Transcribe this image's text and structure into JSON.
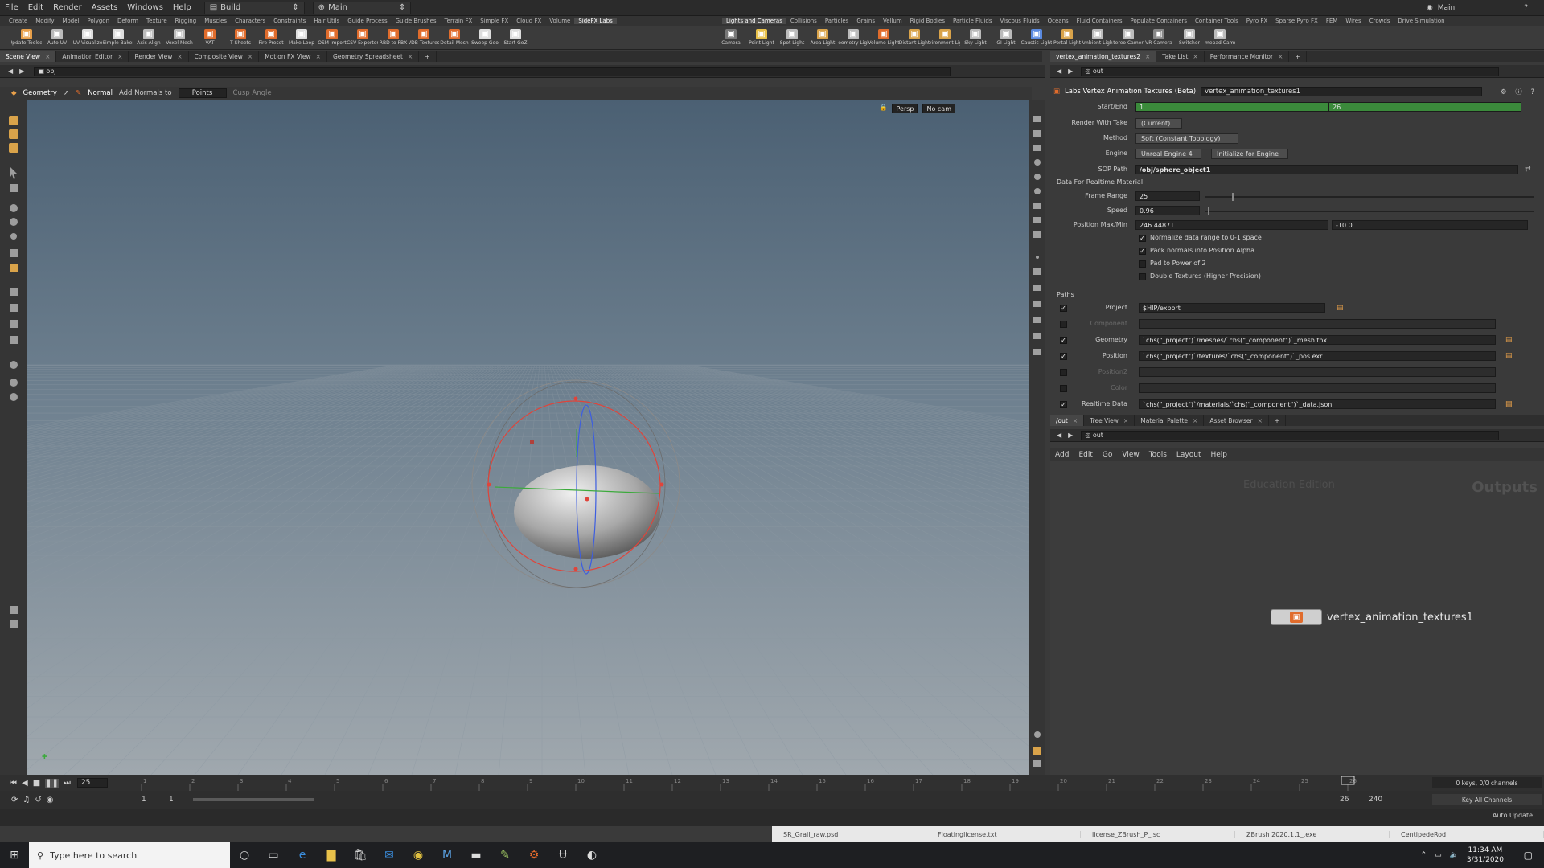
{
  "menubar": {
    "items": [
      "File",
      "Edit",
      "Render",
      "Assets",
      "Windows",
      "Help"
    ],
    "desktop": "Build",
    "context": "Main",
    "right_desktop": "Main"
  },
  "shelf_tabs_left": [
    "Create",
    "Modify",
    "Model",
    "Polygon",
    "Deform",
    "Texture",
    "Rigging",
    "Muscles",
    "Characters",
    "Constraints",
    "Hair Utils",
    "Guide Process",
    "Guide Brushes",
    "Terrain FX",
    "Simple FX",
    "Cloud FX",
    "Volume",
    "SideFX Labs"
  ],
  "shelf_tools_left": [
    "Update Toolset",
    "Auto UV",
    "UV Visualize",
    "Simple Baker",
    "Axis Align",
    "Voxel Mesh",
    "VAT",
    "T Sheets",
    "Fire Preset",
    "Make Loop",
    "OSM Import",
    "CSV Exporter",
    "RBD to FBX",
    "VDB Textures",
    "Detail Mesh",
    "Sweep Geo",
    "Start GoZ"
  ],
  "shelf_tabs_right": [
    "Lights and Cameras",
    "Collisions",
    "Particles",
    "Grains",
    "Vellum",
    "Rigid Bodies",
    "Particle Fluids",
    "Viscous Fluids",
    "Oceans",
    "Fluid Containers",
    "Populate Containers",
    "Container Tools",
    "Pyro FX",
    "Sparse Pyro FX",
    "FEM",
    "Wires",
    "Crowds",
    "Drive Simulation"
  ],
  "shelf_tools_right": [
    "Camera",
    "Point Light",
    "Spot Light",
    "Area Light",
    "Geometry Light",
    "Volume Light",
    "Distant Light",
    "Environment Light",
    "Sky Light",
    "GI Light",
    "Caustic Light",
    "Portal Light",
    "Ambient Light",
    "Stereo Camera",
    "VR Camera",
    "Switcher",
    "Gamepad Camera"
  ],
  "left_pane_tabs": [
    "Scene View",
    "Animation Editor",
    "Render View",
    "Composite View",
    "Motion FX View",
    "Geometry Spreadsheet"
  ],
  "left_path": "obj",
  "viewport_options": {
    "mode": "Geometry",
    "normal_label": "Normal",
    "add_normals_label": "Add Normals to",
    "add_normals_value": "Points",
    "cusp_label": "Cusp Angle",
    "persp": "Persp",
    "cam": "No cam"
  },
  "right_top_tabs": [
    "vertex_animation_textures2",
    "Take List",
    "Performance Monitor"
  ],
  "right_top_path": "out",
  "node": {
    "type": "Labs Vertex Animation Textures (Beta)",
    "name": "vertex_animation_textures1"
  },
  "params": {
    "start_end_label": "Start/End",
    "start": "1",
    "end": "26",
    "render_take_label": "Render With Take",
    "render_take": "(Current)",
    "method_label": "Method",
    "method": "Soft (Constant Topology)",
    "engine_label": "Engine",
    "engine": "Unreal Engine 4",
    "init_button": "Initialize for Engine",
    "sop_label": "SOP Path",
    "sop_path": "/obj/sphere_object1",
    "section_realtime": "Data For Realtime Material",
    "frame_range_label": "Frame Range",
    "frame_range": "25",
    "speed_label": "Speed",
    "speed": "0.96",
    "pos_maxmin_label": "Position Max/Min",
    "pos_max": "246.44871",
    "pos_min": "-10.0",
    "checks": [
      {
        "label": "Normalize data range to 0-1 space",
        "checked": true
      },
      {
        "label": "Pack normals into Position Alpha",
        "checked": true
      },
      {
        "label": "Pad to Power of 2",
        "checked": false
      },
      {
        "label": "Double Textures (Higher Precision)",
        "checked": false
      }
    ],
    "section_paths": "Paths",
    "paths": [
      {
        "label": "Project",
        "value": "$HIP/export",
        "enabled": true
      },
      {
        "label": "Component",
        "value": "",
        "enabled": false
      },
      {
        "label": "Geometry",
        "value": "`chs(\"_project\")`/meshes/`chs(\"_component\")`_mesh.fbx",
        "enabled": true
      },
      {
        "label": "Position",
        "value": "`chs(\"_project\")`/textures/`chs(\"_component\")`_pos.exr",
        "enabled": true
      },
      {
        "label": "Position2",
        "value": "",
        "enabled": false
      },
      {
        "label": "Color",
        "value": "",
        "enabled": false
      },
      {
        "label": "Realtime Data",
        "value": "`chs(\"_project\")`/materials/`chs(\"_component\")`_data.json",
        "enabled": true
      }
    ]
  },
  "net_tabs": [
    "/out",
    "Tree View",
    "Material Palette",
    "Asset Browser"
  ],
  "net_path": "out",
  "net_menu": [
    "Add",
    "Edit",
    "Go",
    "View",
    "Tools",
    "Layout",
    "Help"
  ],
  "net_watermark": "Education Edition",
  "net_context": "Outputs",
  "net_node_label": "vertex_animation_textures1",
  "timeline": {
    "current_frame": "25",
    "ticks": [
      "1",
      "2",
      "3",
      "4",
      "5",
      "6",
      "7",
      "8",
      "9",
      "10",
      "11",
      "12",
      "13",
      "14",
      "15",
      "16",
      "17",
      "18",
      "19",
      "20",
      "21",
      "22",
      "23",
      "24",
      "25",
      "26"
    ],
    "range_start": "1",
    "range_start2": "1",
    "range_end": "26",
    "range_end2": "240",
    "keys_info": "0 keys, 0/0 channels",
    "key_all": "Key All Channels",
    "auto_update": "Auto Update"
  },
  "taskbar": {
    "search_placeholder": "Type here to search",
    "time": "11:34 AM",
    "date": "3/31/2020"
  },
  "thumbnails": [
    "SR_Grail_raw.psd",
    "Floatinglicense.txt",
    "license_ZBrush_P_.sc",
    "ZBrush 2020.1.1_.exe",
    "CentipedeRod"
  ],
  "colors": {
    "viewport_top": "#4b6073",
    "viewport_bottom": "#9aa4ab",
    "timebar": "#3b8a3b",
    "node_accent": "#e06c2c"
  }
}
